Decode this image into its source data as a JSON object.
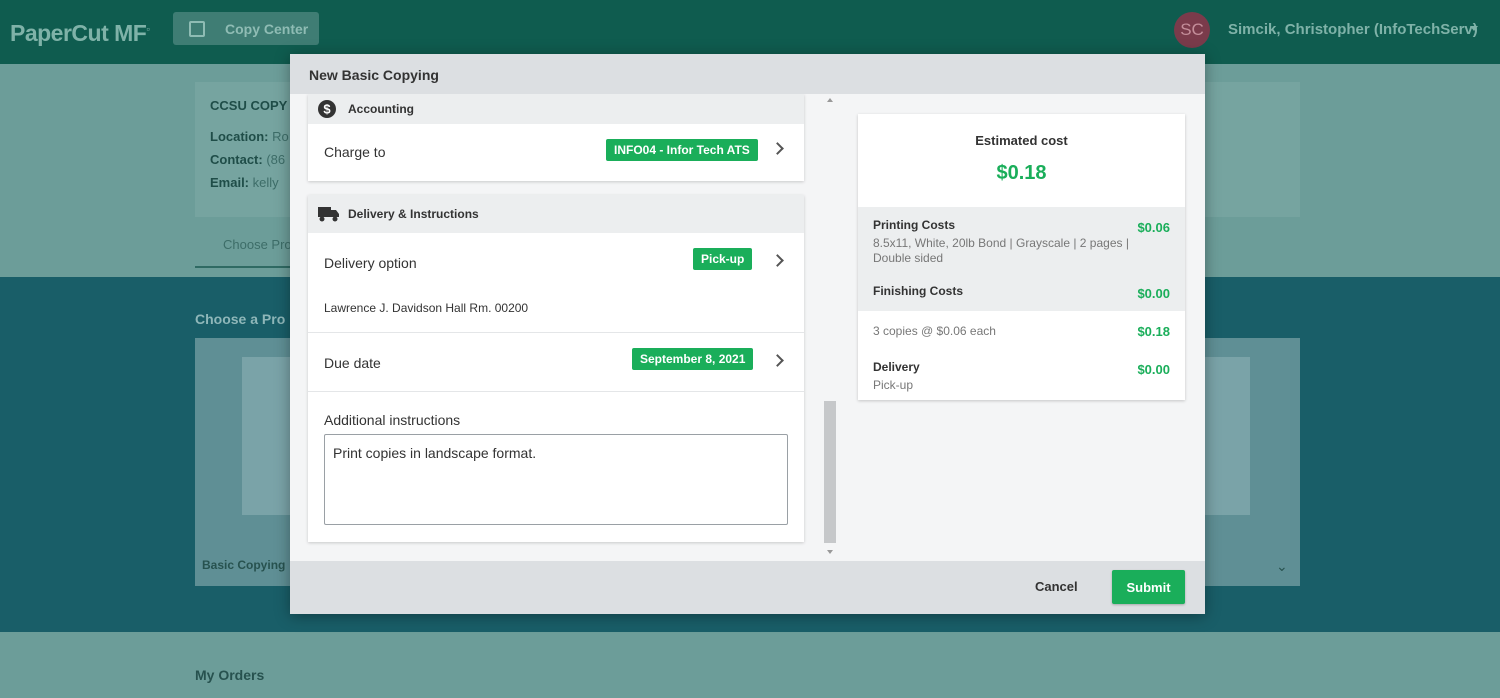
{
  "app": {
    "logo": "PaperCut MF",
    "nav_button": "Copy Center",
    "user_initials": "SC",
    "user_name": "Simcik, Christopher (InfoTechServ)"
  },
  "background": {
    "card_title": "CCSU COPY C",
    "location_label": "Location:",
    "location_value": "Ro",
    "contact_label": "Contact:",
    "contact_value": "(86",
    "email_label": "Email:",
    "email_value": "kelly",
    "tab_label": "Choose Pro",
    "section_title": "Choose a Pro",
    "product_label": "Basic Copying",
    "orders_title": "My Orders"
  },
  "modal": {
    "title": "New Basic Copying",
    "accounting": {
      "heading": "Accounting",
      "charge_to_label": "Charge to",
      "charge_to_value": "INFO04 - Infor Tech ATS"
    },
    "delivery": {
      "heading": "Delivery & Instructions",
      "option_label": "Delivery option",
      "option_value": "Pick-up",
      "address": "Lawrence J. Davidson Hall Rm. 00200",
      "due_label": "Due date",
      "due_value": "September 8, 2021",
      "instructions_label": "Additional instructions",
      "instructions_value": "Print copies in landscape format."
    },
    "cost": {
      "title": "Estimated cost",
      "total": "$0.18",
      "printing_label": "Printing Costs",
      "printing_desc": "8.5x11, White, 20lb Bond | Grayscale | 2 pages | Double sided",
      "printing_value": "$0.06",
      "finishing_label": "Finishing Costs",
      "finishing_value": "$0.00",
      "copies_desc": "3 copies @ $0.06 each",
      "copies_value": "$0.18",
      "delivery_label": "Delivery",
      "delivery_desc": "Pick-up",
      "delivery_value": "$0.00"
    },
    "footer": {
      "cancel": "Cancel",
      "submit": "Submit"
    }
  }
}
